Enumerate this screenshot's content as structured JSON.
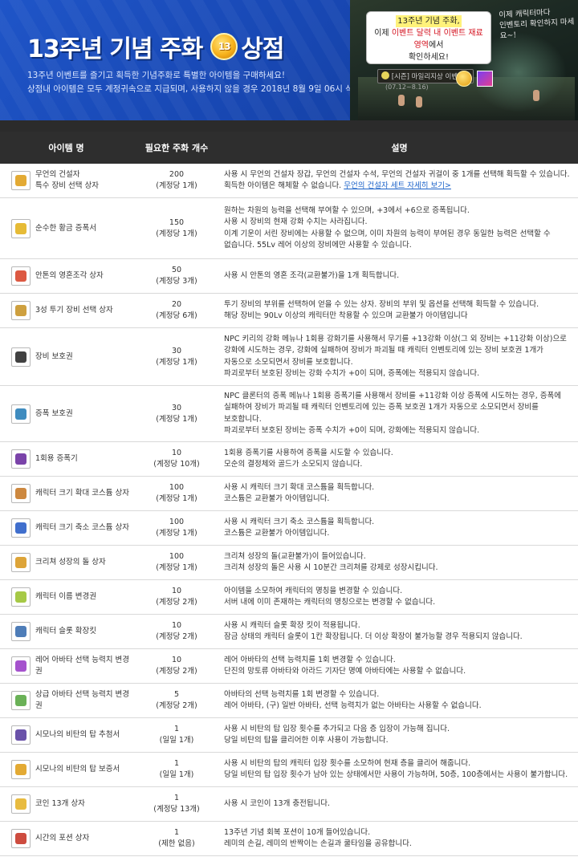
{
  "banner": {
    "title_part1": "13주년 기념 주화",
    "coin_glyph": "13",
    "title_part2": "상점",
    "desc_line1": "13주년 이벤트를 즐기고 획득한 기념주화로 특별한 아이템을 구매하세요!",
    "desc_line2": "상점내 아이템은 모두 계정귀속으로 지급되며, 사용하지 않을 경우 2018년 8월 9일 06시 삭제됩니다.",
    "bubble_line1": "13주년 기념 주화,",
    "bubble_line2_a": "이제 ",
    "bubble_line2_b": "이벤트 달력 내 이벤트 재료 영역",
    "bubble_line2_c": "에서",
    "bubble_line3": "확인하세요!",
    "note_line1": "이제 캐릭터마다",
    "note_line2": "인벤토리 확인하지 마세요~!",
    "event_bar": "[시즌] 마일리지상 이벤트",
    "event_bar_date": "(07.12~8.16)"
  },
  "table": {
    "headers": {
      "name": "아이템 명",
      "price": "필요한 주화 개수",
      "desc": "설명"
    },
    "rows": [
      {
        "name_lines": [
          "무언의 건설자",
          "특수 장비 선택 상자"
        ],
        "price": "200",
        "limit": "(계정당 1개)",
        "desc_lines": [
          "사용 시 무언의 건설자 장갑, 무언의 건설자 수석, 무언의 건설자 귀걸이 중 1개를 선택해 획득할 수 있습니다."
        ],
        "desc_tail": "획득한 아이템은 해체할 수 없습니다.",
        "link": "무언의 건설자 세트 자세히 보기>",
        "icon_color": "#e0a11e"
      },
      {
        "name_lines": [
          "순수한 황금 증폭서"
        ],
        "price": "150",
        "limit": "(계정당 1개)",
        "desc_lines": [
          "원하는 차원의 능력을 선택해 부여할 수 있으며, +3에서 +6으로 증폭됩니다.",
          "사용 시 장비의 현재 강화 수치는 사라집니다.",
          "이계 기운이 서린 장비에는 사용할 수 없으며, 이미 차원의 능력이 부여된 경우 동일한 능력은 선택할 수",
          "없습니다. 55Lv 레어 이상의 장비에만 사용할 수 있습니다."
        ],
        "icon_color": "#e3b420"
      },
      {
        "name_lines": [
          "안톤의 영혼조각 상자"
        ],
        "price": "50",
        "limit": "(계정당 3개)",
        "desc_lines": [
          "사용 시 안톤의 영혼 조각(교환불가)을 1개 획득합니다."
        ],
        "icon_color": "#d8462c"
      },
      {
        "name_lines": [
          "3성 투기 장비 선택 상자"
        ],
        "price": "20",
        "limit": "(계정당 6개)",
        "desc_lines": [
          "투기 장비의 부위를 선택하여 얻을 수 있는 상자. 장비의 부위 및 옵션을 선택해 획득할 수 있습니다.",
          "해당 장비는 90Lv 이상의 캐릭터만 착용할 수 있으며 교환불가 아이템입니다"
        ],
        "icon_color": "#c9962a"
      },
      {
        "name_lines": [
          "장비 보호권"
        ],
        "price": "30",
        "limit": "(계정당 1개)",
        "desc_lines": [
          "NPC 키리의 강화 메뉴나 1회용 강화기를 사용해서 무기를 +13강화 이상(그 외 장비는 +11강화 이상)으로",
          "강화에 시도하는 경우, 강화에 실패하여 장비가 파괴될 때 캐릭터 인벤토리에 있는 장비 보호권 1개가",
          "자동으로 소모되면서 장비를 보호합니다.",
          "파괴로부터 보호된 장비는 강화 수치가 +0이 되며, 증폭에는 적용되지 않습니다."
        ],
        "icon_color": "#2c2c2c"
      },
      {
        "name_lines": [
          "증폭 보호권"
        ],
        "price": "30",
        "limit": "(계정당 1개)",
        "desc_lines": [
          "NPC 클론터의 증폭 메뉴나 1회용 증폭기를 사용해서 장비를 +11강화 이상 증폭에 시도하는 경우, 증폭에",
          "실패하여 장비가 파괴될 때 캐릭터 인벤토리에 있는 증폭 보호권 1개가 자동으로 소모되면서 장비를",
          "보호합니다.",
          "파괴로부터 보호된 장비는 증폭 수치가 +0이 되며, 강화에는 적용되지 않습니다."
        ],
        "icon_color": "#2a7fb8"
      },
      {
        "name_lines": [
          "1회용 증폭기"
        ],
        "price": "10",
        "limit": "(계정당 10개)",
        "desc_lines": [
          "1회용 증폭기를 사용하여 증폭을 시도할 수 있습니다.",
          "모순의 결정체와 골드가 소모되지 않습니다."
        ],
        "icon_color": "#6b2fa0"
      },
      {
        "name_lines": [
          "캐릭터 크기 확대 코스튬 상자"
        ],
        "price": "100",
        "limit": "(계정당 1개)",
        "desc_lines": [
          "사용 시 캐릭터 크기 확대 코스튬을 획득합니다.",
          "코스튬은 교환불가 아이템입니다."
        ],
        "icon_color": "#c87b2a"
      },
      {
        "name_lines": [
          "캐릭터 크기 축소 코스튬 상자"
        ],
        "price": "100",
        "limit": "(계정당 1개)",
        "desc_lines": [
          "사용 시 캐릭터 크기 축소 코스튬을 획득합니다.",
          "코스튬은 교환불가 아이템입니다."
        ],
        "icon_color": "#2b5fc8"
      },
      {
        "name_lines": [
          "크리쳐 성장의 돌 상자"
        ],
        "price": "100",
        "limit": "(계정당 1개)",
        "desc_lines": [
          "크리쳐 성장의 돌(교환불가)이 들어있습니다.",
          "크리쳐 성장의 돌은 사용 시 10분간 크리쳐를 강제로 성장시킵니다."
        ],
        "icon_color": "#d99a22"
      },
      {
        "name_lines": [
          "캐릭터 이름 변경권"
        ],
        "price": "10",
        "limit": "(계정당 2개)",
        "desc_lines": [
          "아이템을 소모하여 캐릭터의 명칭을 변경할 수 있습니다.",
          "서버 내에 이미 존재하는 캐릭터의 명칭으로는 변경할 수 없습니다."
        ],
        "icon_color": "#9cc332"
      },
      {
        "name_lines": [
          "캐릭터 슬롯 확장킷"
        ],
        "price": "10",
        "limit": "(계정당 2개)",
        "desc_lines": [
          "사용 시 캐릭터 슬롯 확장 킷이 적용됩니다.",
          "잠금 상태의 캐릭터 슬롯이 1칸 확장됩니다. 더 이상 확장이 불가능할 경우 적용되지 않습니다."
        ],
        "icon_color": "#3b6fb0"
      },
      {
        "name_lines": [
          "레어 아바타 선택 능력치 변경권"
        ],
        "price": "10",
        "limit": "(계정당 2개)",
        "desc_lines": [
          "레어 아바타의 선택 능력치를 1회 변경할 수 있습니다.",
          "단진의 망토류 아바타와 아라드 기자단 명예 아바타에는 사용할 수 없습니다."
        ],
        "icon_color": "#9b3fc8"
      },
      {
        "name_lines": [
          "상급 아바타 선택 능력치 변경권"
        ],
        "price": "5",
        "limit": "(계정당 2개)",
        "desc_lines": [
          "아바타의 선택 능력치를 1회 변경할 수 있습니다.",
          "레어 아바타, (구) 일반 아바타, 선택 능력치가 없는 아바타는 사용할 수 없습니다."
        ],
        "icon_color": "#5aa845"
      },
      {
        "name_lines": [
          "시모나의 비탄의 탑 추첨서"
        ],
        "price": "1",
        "limit": "(일일 1개)",
        "desc_lines": [
          "사용 시 비탄의 탑 입장 횟수를 추가되고 다음 층 입장이 가능해 집니다.",
          "당일 비탄의 탑을 클리어한 이후 사용이 가능합니다."
        ],
        "icon_color": "#5a3fa0"
      },
      {
        "name_lines": [
          "시모나의 비탄의 탑 보증서"
        ],
        "price": "1",
        "limit": "(일일 1개)",
        "desc_lines": [
          "사용 시 비탄의 탑의 캐릭터 입장 횟수를 소모하여 현재 층을 클리어 해줍니다.",
          "당일 비탄의 탑 입장 횟수가 남아 있는 상태에서만 사용이 가능하며, 50층, 100층에서는 사용이 불가합니다."
        ],
        "icon_color": "#e0a11e"
      },
      {
        "name_lines": [
          "코인 13개 상자"
        ],
        "price": "1",
        "limit": "(계정당 13개)",
        "desc_lines": [
          "사용 시 코인이 13개 충전됩니다."
        ],
        "icon_color": "#e6b42a"
      },
      {
        "name_lines": [
          "시간의 포션 상자"
        ],
        "price": "1",
        "limit": "(제한 없음)",
        "desc_lines": [
          "13주년 기념 회복 포션이 10개 들어있습니다.",
          "레미의 손길, 레미의 반짝이는 손길과 쿨타임을 공유합니다."
        ],
        "icon_color": "#c8382a"
      }
    ]
  }
}
